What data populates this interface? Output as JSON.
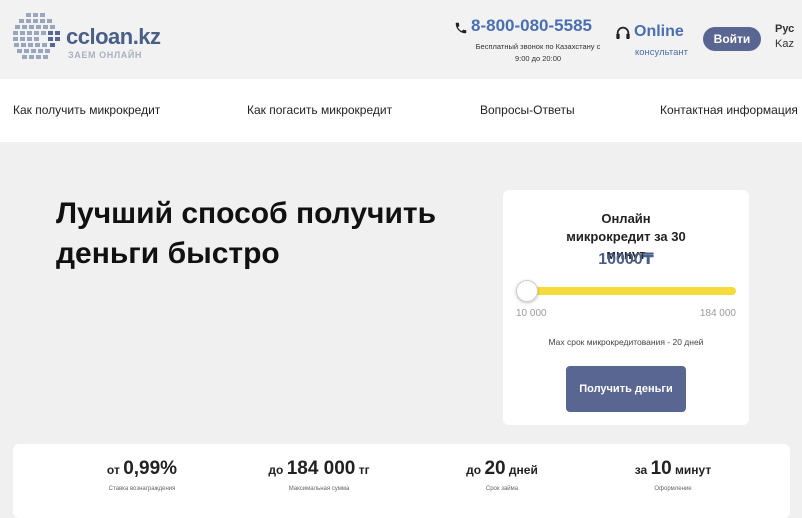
{
  "header": {
    "logo_title": "ccloan.kz",
    "logo_subtitle": "ЗАЕМ ОНЛАЙН",
    "phone": "8-800-080-5585",
    "phone_note": "Бесплатный звонок по Казахстану с 9:00 до 20:00",
    "online_title": "Online",
    "online_subtitle": "консультант",
    "login_label": "Войти",
    "lang_active": "Рус",
    "lang_other": "Kaz",
    "brand_color": "#4a6fb0",
    "button_color": "#5a6692"
  },
  "nav": {
    "items": [
      {
        "label": "Как получить микрокредит"
      },
      {
        "label": "Как погасить микрокредит"
      },
      {
        "label": "Вопросы-Ответы"
      },
      {
        "label": "Контактная информация"
      }
    ]
  },
  "hero": {
    "title": "Лучший способ получить деньги быстро"
  },
  "calculator": {
    "title": "Онлайн микрокредит за 30 минут",
    "amount": "10000₸",
    "slider_min": "10 000",
    "slider_max": "184 000",
    "slider_fraction": 0.0,
    "note": "Max срок микрокредитования - 20 дней",
    "button_label": "Получить деньги",
    "slider_color": "#f6dc3a"
  },
  "stats": [
    {
      "prefix": "от",
      "value": "0,99%",
      "suffix": "",
      "label": "Ставка вознаграждения"
    },
    {
      "prefix": "до",
      "value": "184 000",
      "suffix": "тг",
      "label": "Максимальная сумма"
    },
    {
      "prefix": "до",
      "value": "20",
      "suffix": "дней",
      "label": "Срок займа"
    },
    {
      "prefix": "за",
      "value": "10",
      "suffix": "минут",
      "label": "Оформление"
    }
  ]
}
